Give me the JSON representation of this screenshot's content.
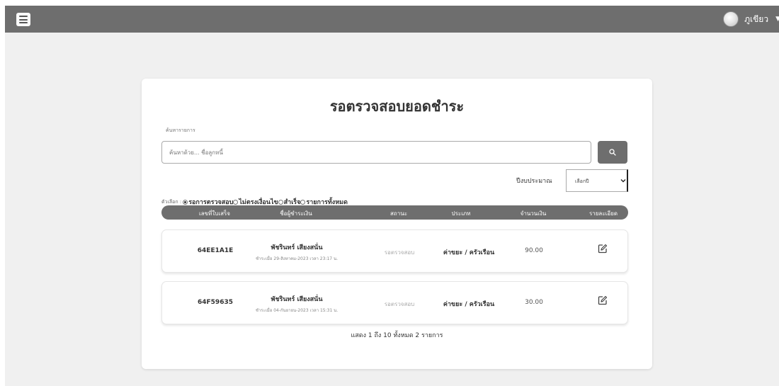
{
  "user": {
    "name": "ภูเขียว"
  },
  "page": {
    "title": "รอตรวจสอบยอดชำระ"
  },
  "search": {
    "label": "ค้นหารายการ",
    "placeholder": "ค้นหาด้วย... ชื่อลูกหนี้",
    "button_icon": "search-icon"
  },
  "year": {
    "label": "ปีงบประมาณ",
    "selected": "เลือกปี"
  },
  "filter": {
    "label": "ตัวเลือก :",
    "options": [
      {
        "label": "รอการตรวจสอบ",
        "selected": true
      },
      {
        "label": "ไม่ตรงเงื่อนไข",
        "selected": false
      },
      {
        "label": "สำเร็จ",
        "selected": false
      },
      {
        "label": "รายการทั้งหมด",
        "selected": false
      }
    ]
  },
  "table": {
    "headers": [
      "เลขที่ใบเสร็จ",
      "ชื่อผู้ชำระเงิน",
      "สถานะ",
      "ประเภท",
      "จำนวนเงิน",
      "รายละเอียด"
    ],
    "rows": [
      {
        "receipt": "64EE1A1E",
        "payer": "พัชรินทร์ เสียงสนั่น",
        "paid_at": "ชำระเมื่อ 29-สิงหาคม-2023 เวลา 23:17 น.",
        "status": "รอตรวจสอบ",
        "type": "ค่าขยะ / ครัวเรือน",
        "amount": "90.00"
      },
      {
        "receipt": "64F59635",
        "payer": "พัชรินทร์ เสียงสนั่น",
        "paid_at": "ชำระเมื่อ 04-กันยายน-2023 เวลา 15:31 น.",
        "status": "รอตรวจสอบ",
        "type": "ค่าขยะ / ครัวเรือน",
        "amount": "30.00"
      }
    ]
  },
  "pagination": {
    "text": "แสดง 1 ถึง 10 ทั้งหมด 2 รายการ"
  },
  "colors": {
    "header_bar": "#6e6e6e",
    "background": "#f0f0f0",
    "card": "#ffffff"
  }
}
